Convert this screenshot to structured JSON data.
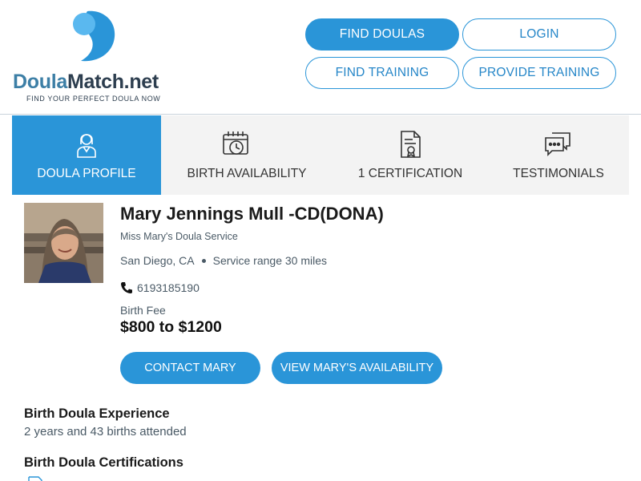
{
  "logo": {
    "name_part1": "Doula",
    "name_part2": "Match.net",
    "tagline": "FIND YOUR PERFECT DOULA NOW",
    "color_primary": "#3d7fa6",
    "color_light": "#5ab8ef"
  },
  "nav": {
    "find_doulas": "FIND DOULAS",
    "login": "LOGIN",
    "find_training": "FIND TRAINING",
    "provide_training": "PROVIDE TRAINING"
  },
  "tabs": [
    {
      "label": "DOULA PROFILE",
      "icon": "doula-profile-icon",
      "active": true
    },
    {
      "label": "BIRTH AVAILABILITY",
      "icon": "calendar-clock-icon",
      "active": false
    },
    {
      "label": "1 CERTIFICATION",
      "icon": "certificate-icon",
      "active": false
    },
    {
      "label": "TESTIMONIALS",
      "icon": "chat-bubbles-icon",
      "active": false
    }
  ],
  "profile": {
    "name": "Mary Jennings Mull -CD(DONA)",
    "service": "Miss Mary's Doula Service",
    "location": "San Diego, CA",
    "range": "Service range 30 miles",
    "phone": "6193185190",
    "fee_label": "Birth Fee",
    "fee_value": "$800 to $1200"
  },
  "actions": {
    "contact": "CONTACT MARY",
    "availability": "VIEW MARY'S AVAILABILITY"
  },
  "experience": {
    "title": "Birth Doula Experience",
    "text": "2 years and 43 births attended"
  },
  "certifications": {
    "title": "Birth Doula Certifications"
  },
  "colors": {
    "accent": "#2a95d8",
    "tab_bg": "#f3f3f3",
    "muted_text": "#4a5a66"
  }
}
